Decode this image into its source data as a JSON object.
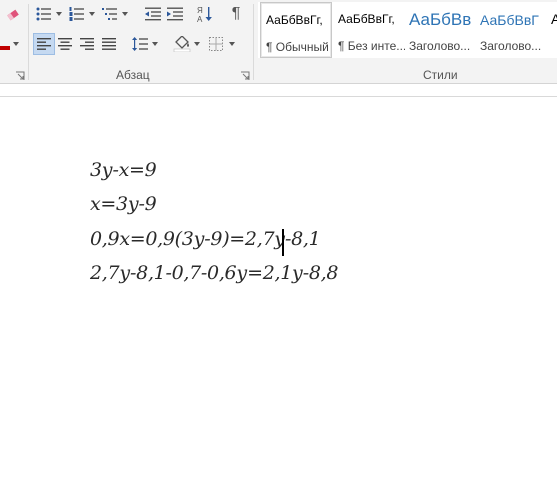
{
  "ribbon": {
    "paragraph_group_label": "Абзац",
    "styles_group_label": "Стили",
    "sort_label": "Я↓ А",
    "pilcrow": "¶"
  },
  "styles": [
    {
      "sample": "АаБбВвГг,",
      "name": "¶ Обычный",
      "kind": "normal",
      "selected": true
    },
    {
      "sample": "АаБбВвГг,",
      "name": "¶ Без инте...",
      "kind": "normal",
      "selected": false
    },
    {
      "sample": "АаБбВв",
      "name": "Заголово...",
      "kind": "heading1",
      "selected": false
    },
    {
      "sample": "АаБбВвГ",
      "name": "Заголово...",
      "kind": "heading2",
      "selected": false
    },
    {
      "sample": "А",
      "name": "",
      "kind": "normal",
      "selected": false
    }
  ],
  "colors": {
    "heading": "#2e74b5",
    "active_align_bg": "#c5d9f1",
    "eraser_pink": "#e0527a",
    "font_color_red": "#c00000"
  },
  "document": {
    "lines": [
      "3у-х=9",
      "х=3у-9",
      "0,9х=0,9(3у-9)=2,7у-8,1",
      "2,7у-8,1-0,7-0,6у=2,1у-8,8"
    ]
  }
}
